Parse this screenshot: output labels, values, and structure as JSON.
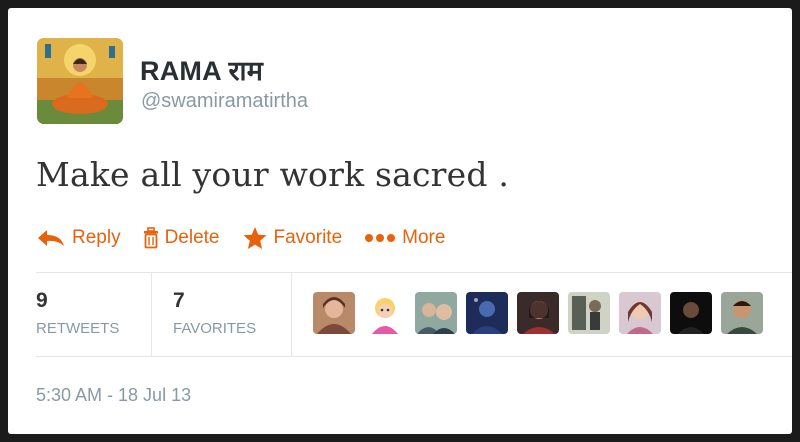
{
  "tweet": {
    "author_name": "RAMA राम",
    "handle": "@swamiramatirtha",
    "text": "Make all your work sacred .",
    "timestamp": "5:30 AM - 18 Jul 13"
  },
  "actions": {
    "reply": {
      "label": "Reply",
      "icon": "reply-arrow-icon"
    },
    "delete": {
      "label": "Delete",
      "icon": "trash-icon"
    },
    "favorite": {
      "label": "Favorite",
      "icon": "star-icon"
    },
    "more": {
      "label": "More",
      "icon": "ellipsis-icon"
    }
  },
  "stats": {
    "retweets": {
      "count": "9",
      "label": "RETWEETS"
    },
    "favorites": {
      "count": "7",
      "label": "FAVORITES"
    }
  },
  "favoriters_avatars_count": 9,
  "colors": {
    "accent": "#e8620c",
    "text": "#333333",
    "muted": "#8899a6",
    "divider": "#e6e6e6",
    "frame": "#1b1b1b"
  }
}
